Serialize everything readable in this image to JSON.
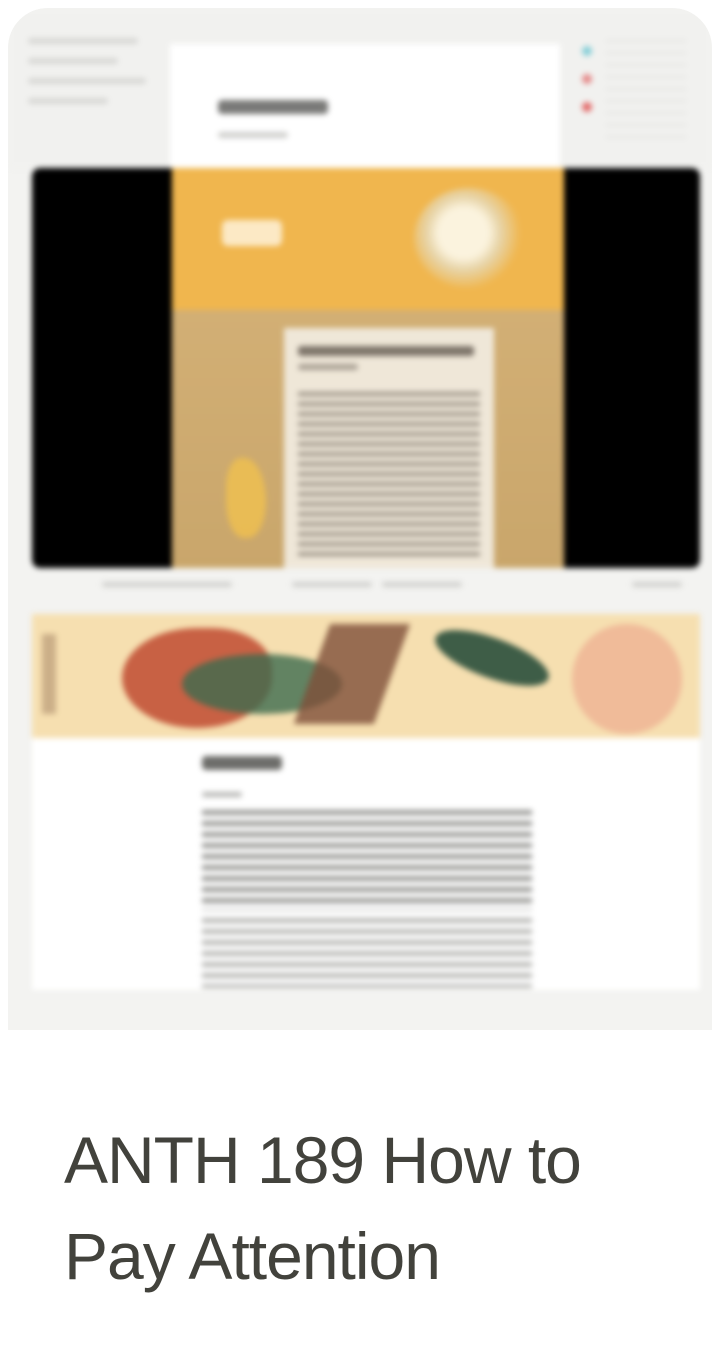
{
  "card": {
    "title": "ANTH 189 How to Pay Attention",
    "thumbnail_icon": "page-preview-thumbnail"
  },
  "colors": {
    "title_text": "#42423c",
    "thumbnail_bg": "#f3f3f1",
    "banner_accent": "#f0b64e",
    "video_bg": "#000000"
  }
}
